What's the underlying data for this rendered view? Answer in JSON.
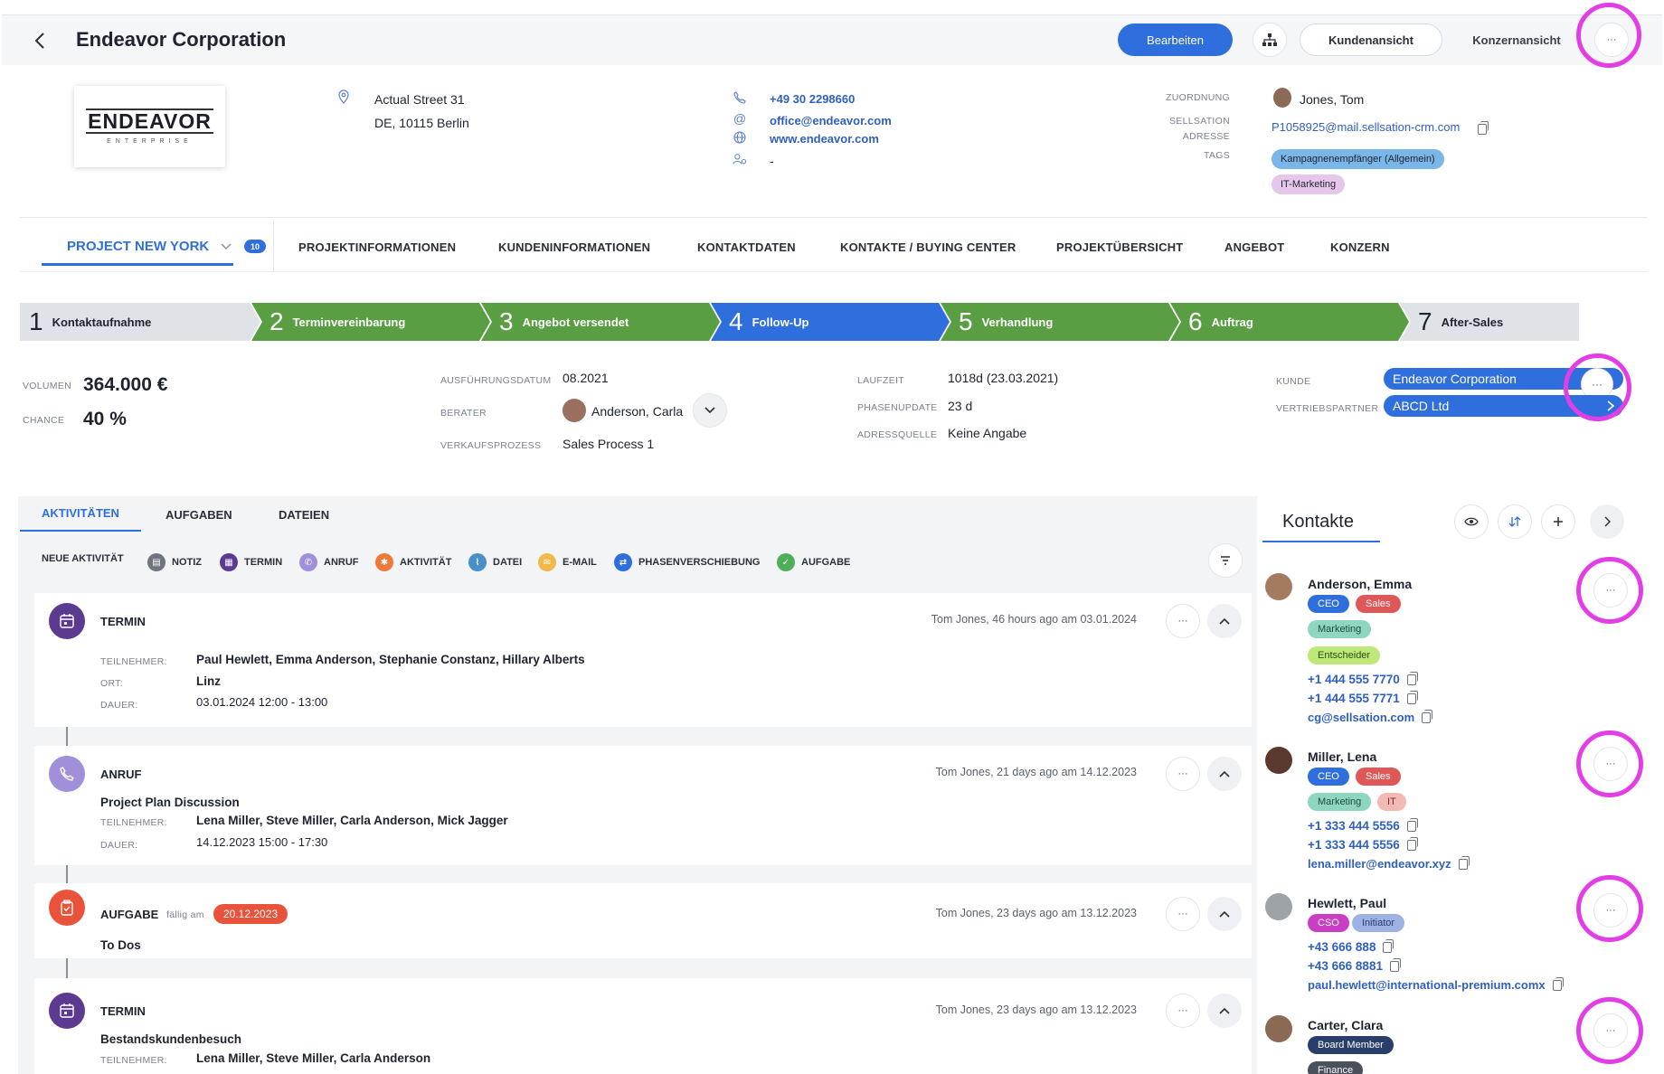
{
  "header": {
    "title": "Endeavor Corporation",
    "edit_label": "Bearbeiten",
    "customer_view_label": "Kundenansicht",
    "group_view_label": "Konzernansicht",
    "more_label": "···"
  },
  "company": {
    "logo_text": "ENDEAVOR",
    "logo_sub": "ENTERPRISE",
    "street": "Actual Street 31",
    "city": "DE, 10115 Berlin",
    "phone": "+49 30 2298660",
    "email": "office@endeavor.com",
    "website": "www.endeavor.com",
    "contact_person": "-",
    "assignment_label": "ZUORDNUNG",
    "assignment_value": "Jones, Tom",
    "sellsation_label_1": "SELLSATION",
    "sellsation_label_2": "ADRESSE",
    "sellsation_value": "P1058925@mail.sellsation-crm.com",
    "tags_label": "TAGS",
    "tags": [
      "Kampagnenempfänger (Allgemein)",
      "IT-Marketing"
    ]
  },
  "tabs": {
    "project": "PROJECT NEW YORK",
    "project_badge": "10",
    "items": [
      "PROJEKTINFORMATIONEN",
      "KUNDENINFORMATIONEN",
      "KONTAKTDATEN",
      "KONTAKTE / BUYING CENTER",
      "PROJEKTÜBERSICHT",
      "ANGEBOT",
      "KONZERN"
    ]
  },
  "pipeline": [
    {
      "num": "1",
      "label": "Kontaktaufnahme",
      "status": "grey"
    },
    {
      "num": "2",
      "label": "Terminvereinbarung",
      "status": "done"
    },
    {
      "num": "3",
      "label": "Angebot versendet",
      "status": "done"
    },
    {
      "num": "4",
      "label": "Follow-Up",
      "status": "current"
    },
    {
      "num": "5",
      "label": "Verhandlung",
      "status": "done"
    },
    {
      "num": "6",
      "label": "Auftrag",
      "status": "done"
    },
    {
      "num": "7",
      "label": "After-Sales",
      "status": "grey"
    }
  ],
  "colors": {
    "done": "#5a9e43",
    "current": "#2f6fdd",
    "grey": "#dfe2e7",
    "accent": "#2f6fdd",
    "highlight": "#e33ee6"
  },
  "details": {
    "volume_label": "VOLUMEN",
    "volume_value": "364.000 €",
    "chance_label": "CHANCE",
    "chance_value": "40 %",
    "exec_date_label": "AUSFÜHRUNGSDATUM",
    "exec_date_value": "08.2021",
    "advisor_label": "BERATER",
    "advisor_value": "Anderson, Carla",
    "sales_process_label": "VERKAUFSPROZESS",
    "sales_process_value": "Sales Process 1",
    "runtime_label": "LAUFZEIT",
    "runtime_value": "1018d (23.03.2021)",
    "phase_update_label": "PHASENUPDATE",
    "phase_update_value": "23 d",
    "address_source_label": "ADRESSQUELLE",
    "address_source_value": "Keine Angabe",
    "customer_label": "KUNDE",
    "customer_value": "Endeavor Corporation",
    "partner_label": "VERTRIEBSPARTNER",
    "partner_value": "ABCD Ltd"
  },
  "activity_tabs": [
    "AKTIVITÄTEN",
    "AUFGABEN",
    "DATEIEN"
  ],
  "filters": {
    "new_label": "NEUE AKTIVITÄT",
    "items": [
      {
        "label": "NOTIZ",
        "color": "#6e7480"
      },
      {
        "label": "TERMIN",
        "color": "#5b3a8f"
      },
      {
        "label": "ANRUF",
        "color": "#a18fd9"
      },
      {
        "label": "AKTIVITÄT",
        "color": "#ee7a3a"
      },
      {
        "label": "DATEI",
        "color": "#4a90c8"
      },
      {
        "label": "E-MAIL",
        "color": "#f1b84a"
      },
      {
        "label": "PHASENVERSCHIEBUNG",
        "color": "#2f6fdd"
      },
      {
        "label": "AUFGABE",
        "color": "#4fae5a"
      }
    ]
  },
  "activities": [
    {
      "type": "TERMIN",
      "meta": "Tom Jones, 46 hours ago am 03.01.2024",
      "rows": [
        {
          "label": "TEILNEHMER:",
          "value": "Paul Hewlett, Emma Anderson, Stephanie Constanz, Hillary Alberts",
          "bold": true
        },
        {
          "label": "ORT:",
          "value": "Linz",
          "bold": true
        },
        {
          "label": "DAUER:",
          "value": "03.01.2024 12:00 - 13:00",
          "bold": false
        }
      ]
    },
    {
      "type": "ANRUF",
      "meta": "Tom Jones, 21 days ago am 14.12.2023",
      "title": "Project Plan Discussion",
      "rows": [
        {
          "label": "TEILNEHMER:",
          "value": "Lena Miller, Steve Miller, Carla Anderson, Mick Jagger",
          "bold": true
        },
        {
          "label": "DAUER:",
          "value": "14.12.2023 15:00 - 17:30",
          "bold": false
        }
      ]
    },
    {
      "type": "AUFGABE",
      "due_label": "fällig am",
      "due_date": "20.12.2023",
      "meta": "Tom Jones, 23 days ago am 13.12.2023",
      "title": "To Dos"
    },
    {
      "type": "TERMIN",
      "meta": "Tom Jones, 23 days ago am 13.12.2023",
      "title": "Bestandskundenbesuch",
      "rows": [
        {
          "label": "TEILNEHMER:",
          "value": "Lena Miller, Steve Miller, Carla Anderson",
          "bold": true
        }
      ]
    }
  ],
  "contacts": {
    "title": "Kontakte",
    "people": [
      {
        "name": "Anderson, Emma",
        "tags": [
          "CEO",
          "Sales",
          "Marketing",
          "Entscheider"
        ],
        "phones": [
          "+1 444 555 7770",
          "+1 444 555 7771"
        ],
        "email": "cg@sellsation.com"
      },
      {
        "name": "Miller, Lena",
        "tags": [
          "CEO",
          "Sales",
          "Marketing",
          "IT"
        ],
        "phones": [
          "+1 333 444 5556",
          "+1 333 444 5556"
        ],
        "email": "lena.miller@endeavor.xyz"
      },
      {
        "name": "Hewlett, Paul",
        "tags": [
          "CSO",
          "Initiator"
        ],
        "phones": [
          "+43 666 888",
          "+43 666 8881"
        ],
        "email": "paul.hewlett@international-premium.comx"
      },
      {
        "name": "Carter, Clara",
        "tags": [
          "Board Member",
          "Finance"
        ]
      }
    ]
  }
}
